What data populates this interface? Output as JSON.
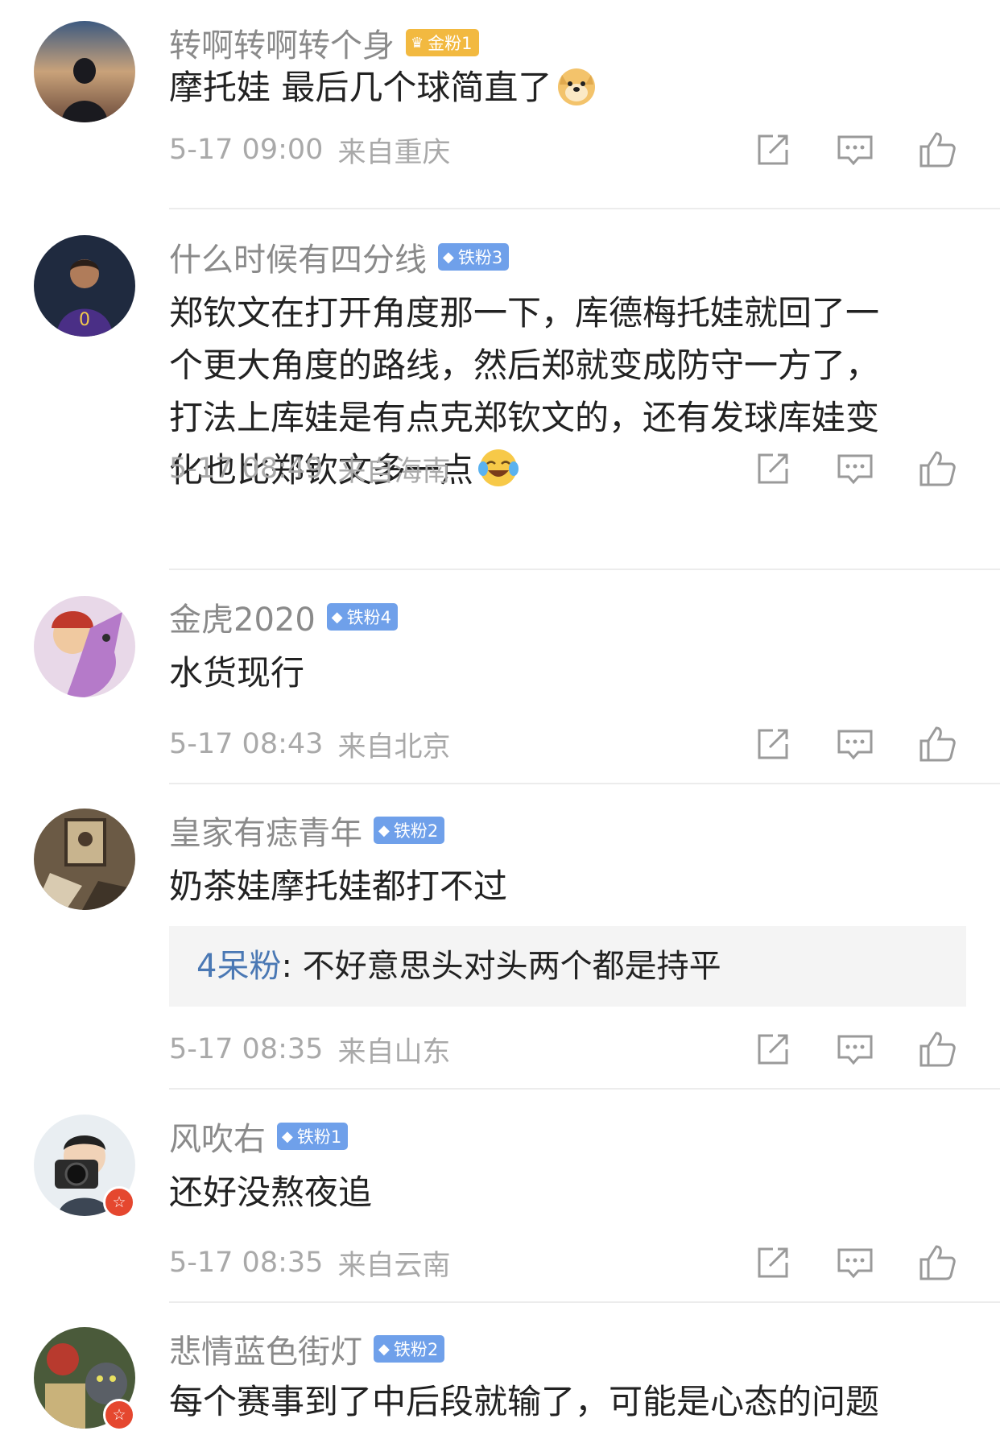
{
  "comments": [
    {
      "username": "转啊转啊转个身",
      "badge": {
        "type": "gold",
        "label": "金粉1"
      },
      "lines": [
        "摩托娃 最后几个球简直了"
      ],
      "emoji": "doge-emoji",
      "time": "5-17 09:00",
      "location": "来自重庆"
    },
    {
      "username": "什么时候有四分线",
      "badge": {
        "type": "iron",
        "label": "铁粉3"
      },
      "lines": [
        "郑钦文在打开角度那一下，库德梅托娃就回了一",
        "个更大角度的路线，然后郑就变成防守一方了，",
        "打法上库娃是有点克郑钦文的，还有发球库娃变",
        "化也比郑钦文多一点"
      ],
      "emoji": "laughing-tears-emoji",
      "time": "5-17 08:49",
      "location": "来自海南"
    },
    {
      "username": "金虎2020",
      "badge": {
        "type": "iron",
        "label": "铁粉4"
      },
      "lines": [
        "水货现行"
      ],
      "time": "5-17 08:43",
      "location": "来自北京"
    },
    {
      "username": "皇家有痣青年",
      "badge": {
        "type": "iron",
        "label": "铁粉2"
      },
      "lines": [
        "奶茶娃摩托娃都打不过"
      ],
      "reply": {
        "name": "4呆粉",
        "text": ": 不好意思头对头两个都是持平"
      },
      "time": "5-17 08:35",
      "location": "来自山东"
    },
    {
      "username": "风吹右",
      "badge": {
        "type": "iron",
        "label": "铁粉1"
      },
      "lines": [
        "还好没熬夜追"
      ],
      "time": "5-17 08:35",
      "location": "来自云南"
    },
    {
      "username": "悲情蓝色街灯",
      "badge": {
        "type": "iron",
        "label": "铁粉2"
      },
      "lines": [
        "每个赛事到了中后段就输了，可能是心态的问题"
      ]
    }
  ]
}
